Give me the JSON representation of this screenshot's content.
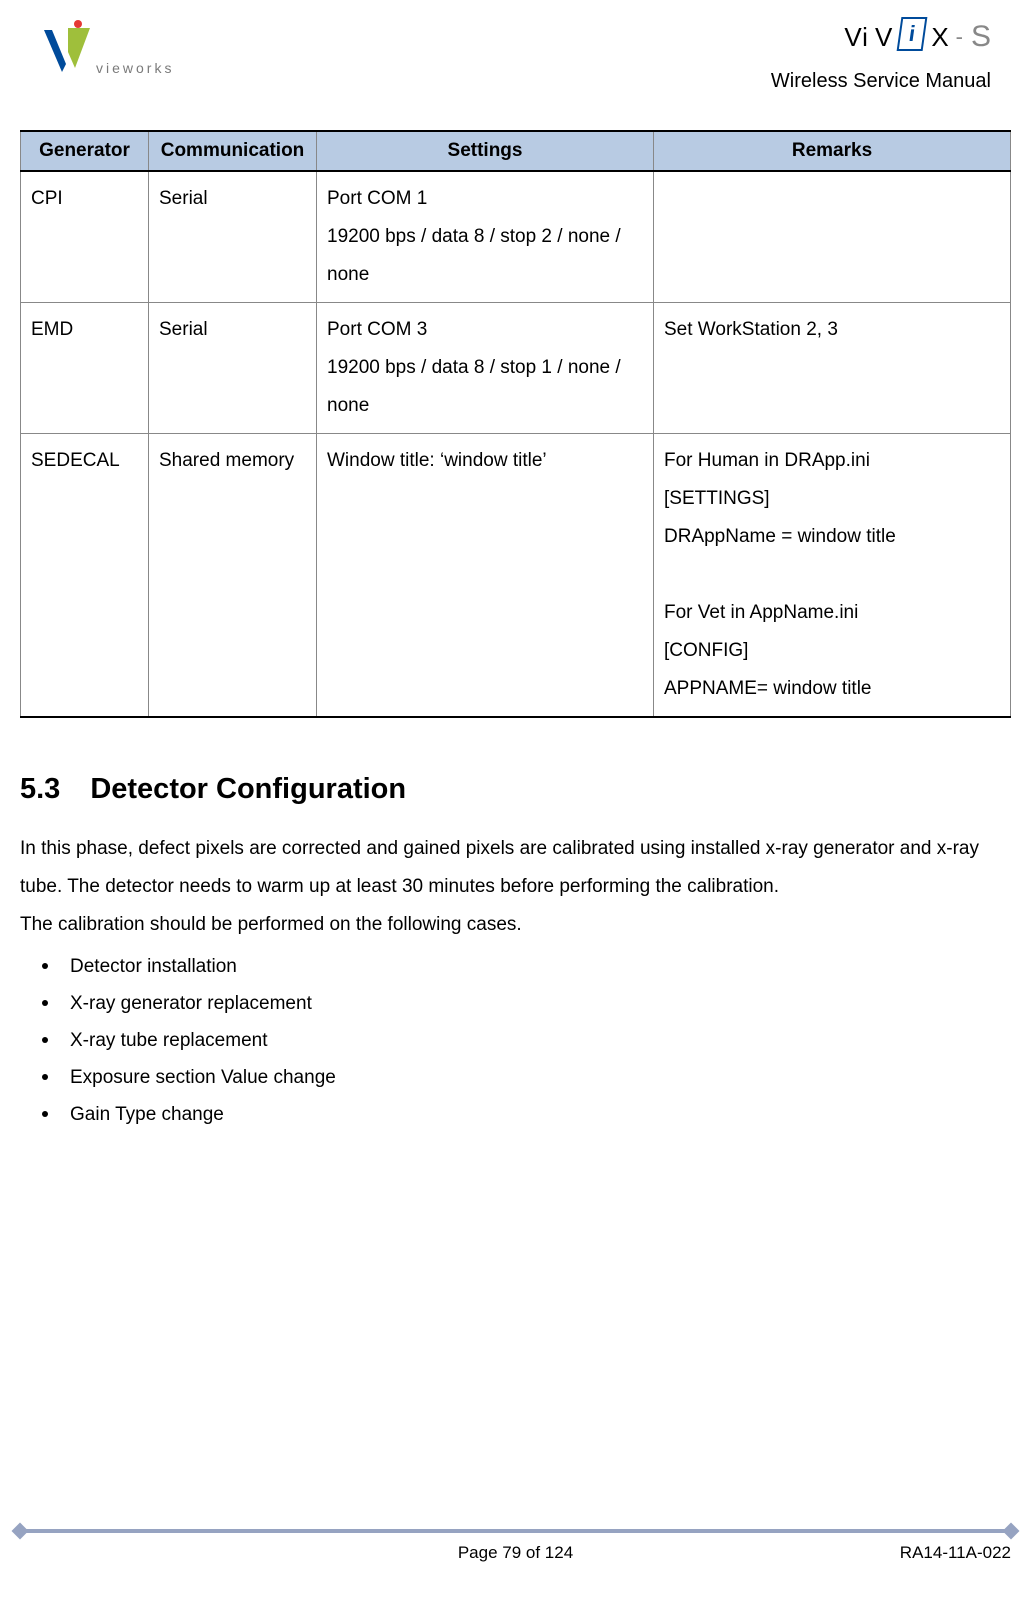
{
  "header": {
    "left_logo_text": "vieworks",
    "right_logo_text_vi": "Vi",
    "right_logo_text_v": "V",
    "right_logo_text_x": "X",
    "right_logo_dash": "-",
    "right_logo_s": "S",
    "doc_title": "Wireless Service Manual"
  },
  "table": {
    "headers": [
      "Generator",
      "Communication",
      "Settings",
      "Remarks"
    ],
    "rows": [
      {
        "generator": "CPI",
        "communication": "Serial",
        "settings": "Port COM 1\n19200 bps / data 8 / stop 2 / none / none",
        "remarks": ""
      },
      {
        "generator": "EMD",
        "communication": "Serial",
        "settings": "Port COM 3\n19200 bps / data 8 / stop 1 / none / none",
        "remarks": "Set WorkStation 2, 3"
      },
      {
        "generator": "SEDECAL",
        "communication": "Shared memory",
        "settings": "Window title: ‘window title’",
        "remarks": "For Human in DRApp.ini\n[SETTINGS]\nDRAppName = window title\n\nFor Vet in AppName.ini\n[CONFIG]\nAPPNAME= window title"
      }
    ]
  },
  "section": {
    "number": "5.3",
    "title": "Detector Configuration",
    "paragraph": "In this phase, defect pixels are corrected and gained pixels are calibrated using installed x-ray generator and x-ray tube. The detector needs to warm up at least 30 minutes before performing the calibration.\nThe calibration should be performed on the following cases.",
    "bullets": [
      "Detector installation",
      "X-ray generator replacement",
      "X-ray tube replacement",
      "Exposure section Value change",
      "Gain Type change"
    ]
  },
  "footer": {
    "page": "Page 79 of 124",
    "docnum": "RA14-11A-022"
  }
}
